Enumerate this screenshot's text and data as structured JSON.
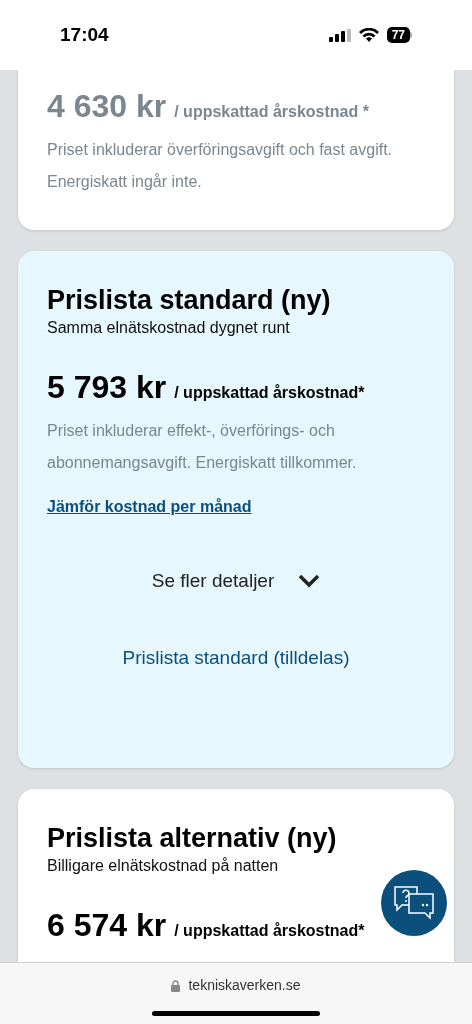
{
  "status_bar": {
    "time": "17:04",
    "battery": "77"
  },
  "cards": [
    {
      "selected": false,
      "dimmed": true,
      "price": "4 630 kr",
      "price_suffix": "/ uppskattad årskostnad *",
      "description": "Priset inkluderar överföringsavgift och fast avgift. Energiskatt ingår inte."
    },
    {
      "selected": true,
      "dimmed": false,
      "title": "Prislista standard (ny)",
      "subtitle": "Samma elnätskostnad dygnet runt",
      "price": "5 793 kr",
      "price_suffix": "/ uppskattad årskostnad*",
      "description": "Priset inkluderar effekt-, överförings- och abonnemangsavgift. Energiskatt tillkommer.",
      "compare_link": "Jämför kostnad per månad",
      "details_toggle": {
        "label": "Se fler detaljer",
        "expanded": false
      },
      "assigned_label": "Prislista standard (tilldelas)"
    },
    {
      "selected": false,
      "dimmed": false,
      "title": "Prislista alternativ (ny)",
      "subtitle": "Billigare elnätskostnad på natten",
      "price": "6 574 kr",
      "price_suffix": "/ uppskattad årskostnad*"
    }
  ],
  "browser_bar": {
    "url": "tekniskaverken.se"
  }
}
